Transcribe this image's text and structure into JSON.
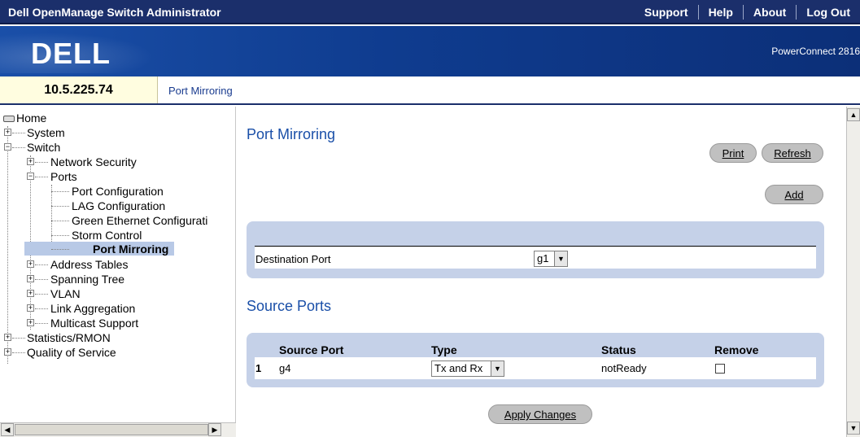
{
  "app": {
    "title": "Dell OpenManage Switch Administrator",
    "logo": "DELL",
    "model": "PowerConnect 2816"
  },
  "toplinks": [
    "Support",
    "Help",
    "About",
    "Log Out"
  ],
  "ip": "10.5.225.74",
  "breadcrumb": "Port Mirroring",
  "tree": {
    "home": "Home",
    "system": "System",
    "switch": "Switch",
    "network_security": "Network Security",
    "ports": "Ports",
    "port_configuration": "Port Configuration",
    "lag_configuration": "LAG Configuration",
    "green_ethernet": "Green Ethernet Configurati",
    "storm_control": "Storm Control",
    "port_mirroring": "Port Mirroring",
    "address_tables": "Address Tables",
    "spanning_tree": "Spanning Tree",
    "vlan": "VLAN",
    "link_aggregation": "Link Aggregation",
    "multicast_support": "Multicast Support",
    "statistics_rmon": "Statistics/RMON",
    "qos": "Quality of Service"
  },
  "main": {
    "title": "Port Mirroring",
    "print": "Print",
    "refresh": "Refresh",
    "add": "Add",
    "destination_label": "Destination Port",
    "destination_value": "g1",
    "source_title": "Source Ports",
    "source_table": {
      "headers": {
        "source_port": "Source Port",
        "type": "Type",
        "status": "Status",
        "remove": "Remove"
      },
      "rows": [
        {
          "index": "1",
          "port": "g4",
          "type": "Tx and Rx",
          "status": "notReady",
          "remove": false
        }
      ]
    },
    "apply": "Apply Changes"
  },
  "colors": {
    "header": "#1b2f6b",
    "accent": "#1a4fa8",
    "panel": "#c5d1e8",
    "ip_bg": "#fffde0"
  }
}
